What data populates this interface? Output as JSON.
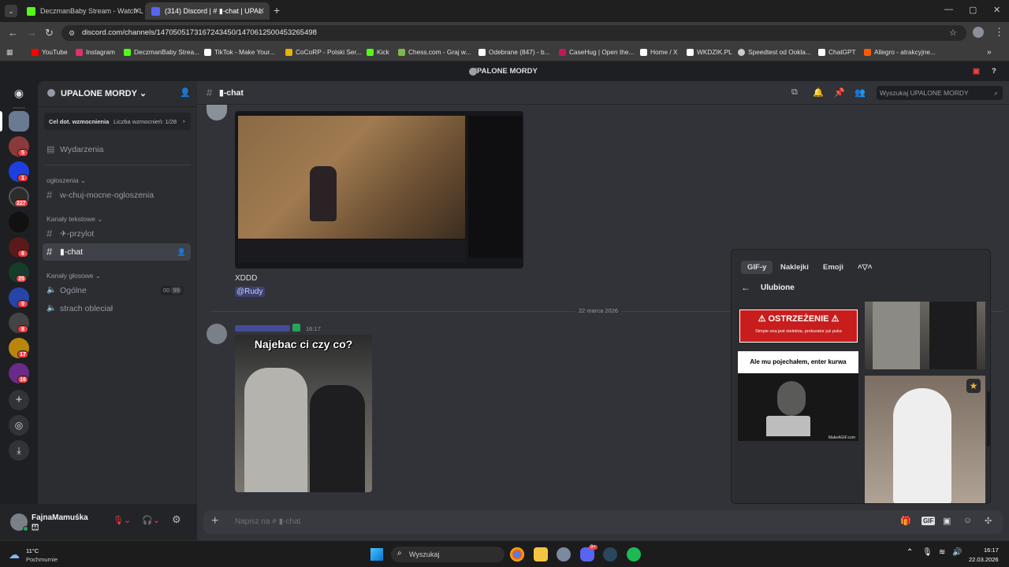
{
  "browser": {
    "tabs": [
      {
        "title": "DeczmanBaby Stream - Watch L",
        "favicon_color": "#53fc18"
      },
      {
        "title": "(314) Discord | # ▮-chat | UPAL",
        "favicon_color": "#f23f43"
      }
    ],
    "new_tab": "+",
    "url": "discord.com/channels/1470505173167243450/1470612500453265498",
    "bookmarks": [
      {
        "label": "YouTube",
        "color": "#ff0000"
      },
      {
        "label": "Instagram",
        "color": "#e1306c"
      },
      {
        "label": "DeczmanBaby Strea...",
        "color": "#53fc18"
      },
      {
        "label": "TikTok - Make Your...",
        "color": "#ffffff"
      },
      {
        "label": "CoCoRP - Polski Ser...",
        "color": "#e8b400"
      },
      {
        "label": "Kick",
        "color": "#53fc18"
      },
      {
        "label": "Chess.com - Graj w...",
        "color": "#81b64c"
      },
      {
        "label": "Odebrane (847) - b...",
        "color": "#ffffff"
      },
      {
        "label": "CaseHug | Open the...",
        "color": "#c2185b"
      },
      {
        "label": "Home / X",
        "color": "#ffffff"
      },
      {
        "label": "WKDZIK.PL",
        "color": "#ffffff"
      },
      {
        "label": "Speedtest od Ookla...",
        "color": "#cccccc"
      },
      {
        "label": "ChatGPT",
        "color": "#ffffff"
      },
      {
        "label": "Allegro - atrakcyjne...",
        "color": "#ff5a00"
      }
    ],
    "more_bookmarks": "»"
  },
  "discord": {
    "window_title": "UPALONE MORDY",
    "server": {
      "name": "UPALONE MORDY",
      "boost_goal": "Cel dot. wzmocnienia",
      "boost_count": "Liczba wzmocnień: 1/28",
      "events": "Wydarzenia",
      "categories": {
        "announcements": "ogłoszenia",
        "text": "Kanały tekstowe",
        "voice": "Kanały głosowe"
      },
      "channels": {
        "announce": "w-chuj-mocne-ogloszenia",
        "przylot": "✈-przylot",
        "chat": "▮-chat",
        "general_voice": "Ogólne",
        "voice_counts": [
          "00",
          "99"
        ],
        "strach": "strach obleciał"
      }
    },
    "server_badges": [
      "5",
      "1",
      "227",
      "6",
      "25",
      "9",
      "8",
      "17",
      "16"
    ],
    "user": {
      "name": "FajnaMamuśka",
      "status_emoji": "👨‍👩‍👧"
    },
    "channel_header": {
      "name": "▮-chat",
      "search_placeholder": "Wyszukaj UPALONE MORDY"
    },
    "messages": {
      "text1": "XDDD",
      "mention": "@Rudy",
      "date_divider": "22 marca 2026",
      "time2": "16:17",
      "meme_caption": "Najebac ci czy co?"
    },
    "composer_placeholder": "Napisz na # ▮-chat",
    "gif_picker": {
      "tabs": [
        "GIF-y",
        "Naklejki",
        "Emoji",
        "˄▽˄"
      ],
      "section": "Ulubione",
      "warning_title": "⚠ OSTRZEŻENIE ⚠",
      "warning_sub": "Simpie ona jest nieletnia, prokurator już puka",
      "caption": "Ale mu pojechałem, enter kurwa",
      "watermark": "MakeAGIF.com"
    }
  },
  "taskbar": {
    "weather_temp": "11°C",
    "weather_text": "Pochmurnie",
    "search": "Wyszukaj",
    "time": "16:17",
    "date": "22.03.2026",
    "discord_badge": "9+"
  }
}
